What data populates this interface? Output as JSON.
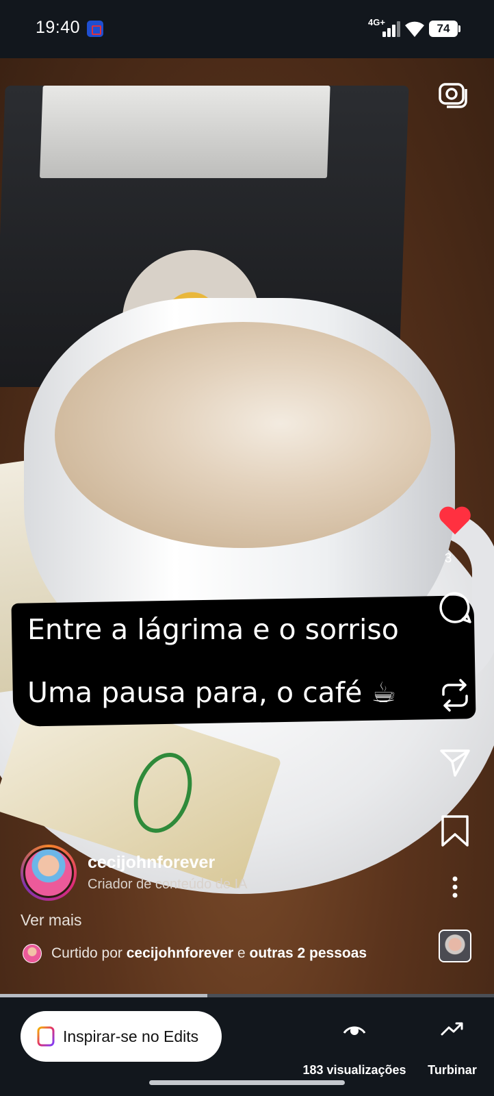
{
  "status_bar": {
    "time": "19:40",
    "network": "4G+",
    "battery": "74",
    "icons": [
      "app-notification-icon",
      "signal-icon",
      "wifi-icon",
      "battery-icon"
    ]
  },
  "reel": {
    "caption_lines": [
      "Entre a lágrima e o sorriso",
      "Uma pausa para, o café ☕"
    ],
    "progress_fraction": 0.42
  },
  "actions": {
    "camera_icon": "camera-icon",
    "like_icon": "heart-icon",
    "like_color": "#ff3040",
    "like_count": "3",
    "comment_icon": "comment-icon",
    "remix_icon": "repost-icon",
    "share_icon": "send-icon",
    "save_icon": "bookmark-icon",
    "more_icon": "more-icon"
  },
  "author": {
    "username": "cecijohnforever",
    "subtitle": "Criador de conteúdo de IA",
    "see_more": "Ver mais"
  },
  "liked_by": {
    "prefix": "Curtido por",
    "user": "cecijohnforever",
    "connector": "e",
    "others": "outras 2 pessoas"
  },
  "bottom_bar": {
    "edits_label": "Inspirar-se no Edits",
    "views_label": "183 visualizações",
    "boost_label": "Turbinar"
  }
}
